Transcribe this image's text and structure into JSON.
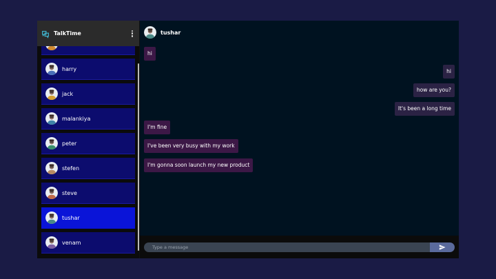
{
  "sidebar": {
    "app_title": "TalkTime",
    "logo_icon": "logo-icon",
    "menu_icon": "more-vertical-icon",
    "contacts": [
      {
        "name": "",
        "avatar_color": "#d08a30"
      },
      {
        "name": "harry",
        "avatar_color": "#4a6fb8"
      },
      {
        "name": "jack",
        "avatar_color": "#d6a032"
      },
      {
        "name": "malankiya",
        "avatar_color": "#3f83a8"
      },
      {
        "name": "peter",
        "avatar_color": "#3a8e6d"
      },
      {
        "name": "stefen",
        "avatar_color": "#b78b62"
      },
      {
        "name": "steve",
        "avatar_color": "#c06a4a"
      },
      {
        "name": "tushar",
        "avatar_color": "#4a8a88"
      },
      {
        "name": "venam",
        "avatar_color": "#7c5fa3"
      }
    ],
    "active_contact": "tushar"
  },
  "chat": {
    "contact_name": "tushar",
    "messages": [
      {
        "text": "hi",
        "direction": "in"
      },
      {
        "text": "hi",
        "direction": "out"
      },
      {
        "text": "how are you?",
        "direction": "out"
      },
      {
        "text": "It's been a long time",
        "direction": "out"
      },
      {
        "text": "I'm fine",
        "direction": "in"
      },
      {
        "text": "I've been very busy with my work",
        "direction": "in"
      },
      {
        "text": "I'm gonna soon launch my new product",
        "direction": "in"
      }
    ],
    "composer": {
      "placeholder": "Type a message",
      "value": "",
      "send_icon": "send-icon"
    }
  },
  "colors": {
    "background": "#1a1b45",
    "contact_bg": "#0c0c6e",
    "contact_active_bg": "#0a14d8",
    "chat_bg": "#001220",
    "bubble_in": "#3c1846",
    "bubble_out": "#2b2244"
  }
}
